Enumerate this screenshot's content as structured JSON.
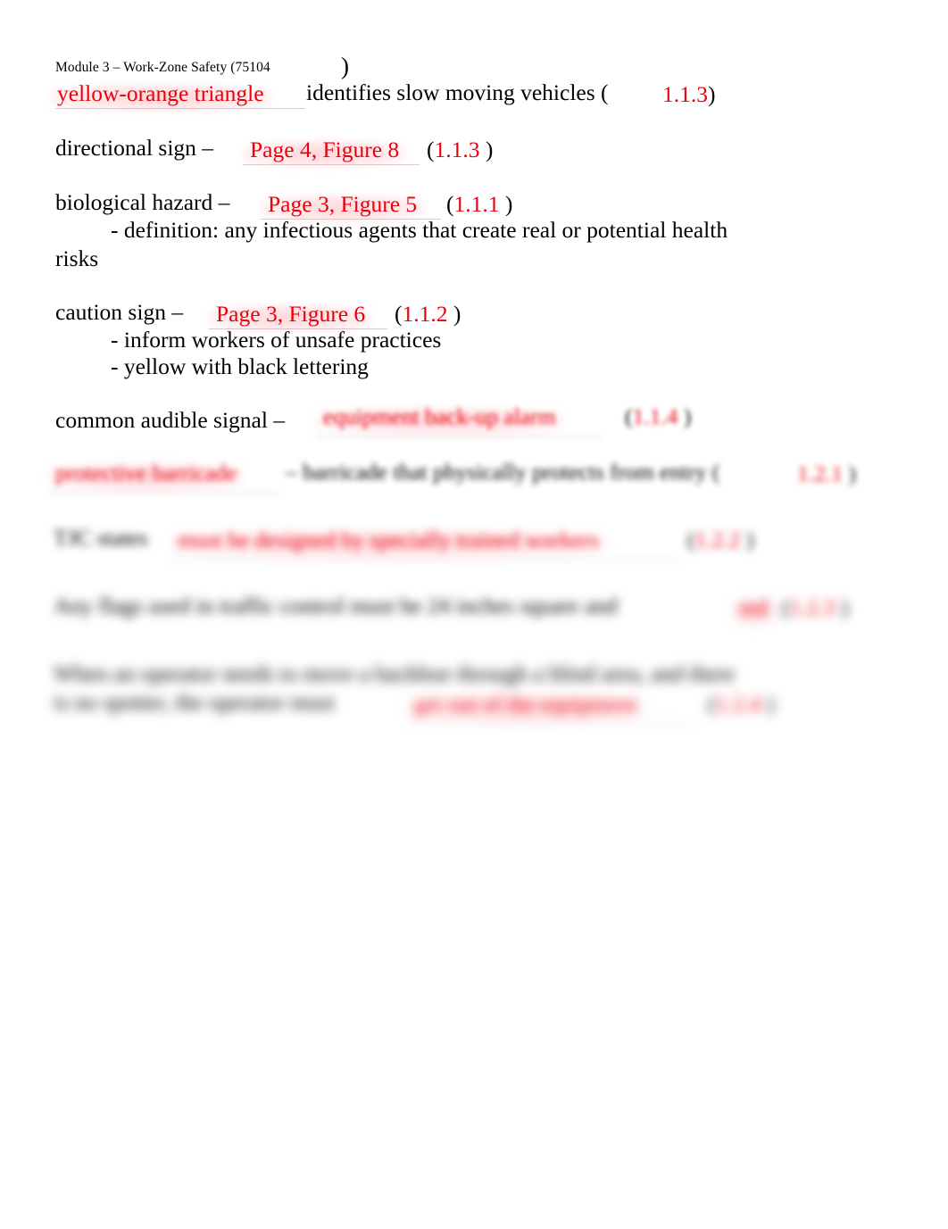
{
  "document": {
    "header": "Module 3 – Work-Zone Safety (75104",
    "header_paren": ")",
    "background_color": "#ffffff",
    "answer_color": "#e8000d",
    "text_color": "#000000"
  },
  "entries": [
    {
      "prompt_before": "",
      "answer": "yellow-orange triangle",
      "prompt_after": "identifies slow moving vehicles (",
      "ref_open": "",
      "ref": "1.1.3",
      "ref_close": ")",
      "notes": []
    },
    {
      "prompt_before": "directional sign –",
      "answer": "Page 4, Figure 8",
      "prompt_after": "",
      "ref_open": "(",
      "ref": "1.1.3",
      "ref_close": ")",
      "notes": []
    },
    {
      "prompt_before": "biological hazard –",
      "answer": "Page 3, Figure 5",
      "prompt_after": "",
      "ref_open": "(",
      "ref": "1.1.1",
      "ref_close": ")",
      "notes": [
        "- definition: any infectious agents that create real or potential health",
        "risks"
      ]
    },
    {
      "prompt_before": "caution sign –",
      "answer": "Page 3, Figure 6",
      "prompt_after": "",
      "ref_open": "(",
      "ref": "1.1.2",
      "ref_close": ")",
      "notes": [
        "- inform workers of unsafe practices",
        "- yellow with black lettering"
      ]
    },
    {
      "prompt_before": "common audible signal –",
      "answer": "equipment back-up alarm",
      "prompt_after": "",
      "ref_open": "(",
      "ref": "1.1.4",
      "ref_close": ")",
      "notes": [],
      "redacted": true
    },
    {
      "prompt_before": "",
      "answer": "protective barricade",
      "prompt_after": "– barricade that physically protects from entry (",
      "ref_open": "",
      "ref": "1.2.1",
      "ref_close": ")",
      "notes": [],
      "redacted": true
    },
    {
      "prompt_before": "TJC states",
      "answer": "must be designed by specially trained workers",
      "prompt_after": "",
      "ref_open": "(",
      "ref": "1.2.2",
      "ref_close": ")",
      "notes": [],
      "redacted": true
    },
    {
      "prompt_before": "Any flags used in traffic control must be 24 inches square and",
      "answer": "red",
      "prompt_after": "",
      "ref_open": "(",
      "ref": "1.2.3",
      "ref_close": ")",
      "notes": [],
      "redacted": true
    },
    {
      "prompt_before": "When an operator needs to move a backhoe through a blind area, and there",
      "prompt_line2": "is no spotter, the operator must",
      "answer": "get out of the equipment",
      "prompt_after": "",
      "ref_open": "(",
      "ref": "1.2.4",
      "ref_close": ")",
      "notes": [],
      "redacted": true
    }
  ]
}
